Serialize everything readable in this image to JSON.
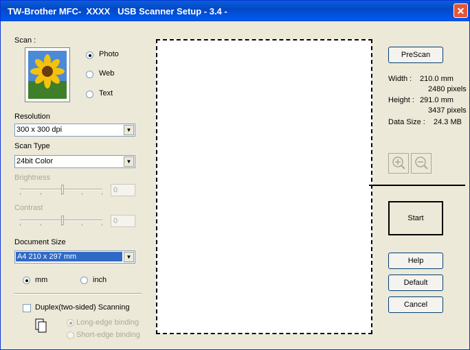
{
  "window": {
    "title": "TW-Brother MFC-  XXXX   USB Scanner Setup - 3.4 -",
    "close_glyph": "✕"
  },
  "scan": {
    "label": "Scan :",
    "thumbnail_icon": "sunflower-photo-icon",
    "options": [
      {
        "label": "Photo",
        "checked": true
      },
      {
        "label": "Web",
        "checked": false
      },
      {
        "label": "Text",
        "checked": false
      }
    ]
  },
  "resolution": {
    "label": "Resolution",
    "value": "300 x 300 dpi"
  },
  "scan_type": {
    "label": "Scan Type",
    "value": "24bit Color"
  },
  "brightness": {
    "label": "Brightness",
    "value": "0"
  },
  "contrast": {
    "label": "Contrast",
    "value": "0"
  },
  "document_size": {
    "label": "Document Size",
    "value": "A4 210 x 297 mm"
  },
  "units": [
    {
      "label": "mm",
      "checked": true
    },
    {
      "label": "inch",
      "checked": false
    }
  ],
  "duplex": {
    "label": "Duplex(two-sided) Scanning",
    "checked": false,
    "options": [
      {
        "label": "Long-edge binding",
        "checked": true
      },
      {
        "label": "Short-edge binding",
        "checked": false
      }
    ]
  },
  "right_panel": {
    "prescan_label": "PreScan",
    "width_label": "Width :",
    "width_mm": "210.0 mm",
    "width_px": "2480 pixels",
    "height_label": "Height :",
    "height_mm": "291.0 mm",
    "height_px": "3437 pixels",
    "data_size_label": "Data Size :",
    "data_size": "24.3 MB",
    "start_label": "Start",
    "help_label": "Help",
    "default_label": "Default",
    "cancel_label": "Cancel"
  }
}
